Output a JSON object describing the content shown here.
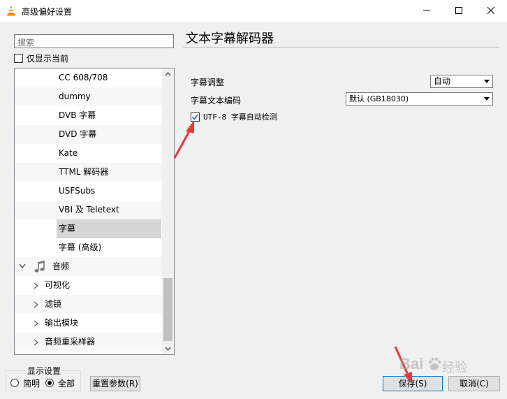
{
  "window": {
    "title": "高级偏好设置"
  },
  "sidebar": {
    "search_placeholder": "搜索",
    "only_current_label": "仅显示当前",
    "tree_items": [
      {
        "label": "CC 608/708",
        "level": 2
      },
      {
        "label": "dummy",
        "level": 2
      },
      {
        "label": "DVB 字幕",
        "level": 2
      },
      {
        "label": "DVD 字幕",
        "level": 2
      },
      {
        "label": "Kate",
        "level": 2
      },
      {
        "label": "TTML 解码器",
        "level": 2
      },
      {
        "label": "USFSubs",
        "level": 2
      },
      {
        "label": "VBI 及 Teletext",
        "level": 2
      },
      {
        "label": "字幕",
        "level": 2,
        "selected": true
      },
      {
        "label": "字幕 (高级)",
        "level": 2
      },
      {
        "label": "音频",
        "level": 0,
        "icon": "music-note-icon",
        "expanded": true
      },
      {
        "label": "可视化",
        "level": 1
      },
      {
        "label": "滤镜",
        "level": 1
      },
      {
        "label": "输出模块",
        "level": 1
      },
      {
        "label": "音频重采样器",
        "level": 1
      }
    ]
  },
  "display_settings": {
    "title": "显示设置",
    "simple_label": "简明",
    "all_label": "全部",
    "selected": "全部"
  },
  "buttons": {
    "reset": "重置参数(R)",
    "save": "保存(S)",
    "cancel": "取消(C)"
  },
  "panel": {
    "title": "文本字幕解码器",
    "rows": {
      "adjust_label": "字幕调整",
      "adjust_value": "自动",
      "encoding_label": "字幕文本编码",
      "encoding_value": "默认 (GB18030)",
      "utf8_label": "UTF-8 字幕自动检测",
      "utf8_checked": true
    }
  },
  "watermark": {
    "brand": "Bai",
    "suffix": "经验"
  },
  "colors": {
    "accent": "#0078d7",
    "annotation": "#e8383d",
    "check": "#0a64c8"
  }
}
